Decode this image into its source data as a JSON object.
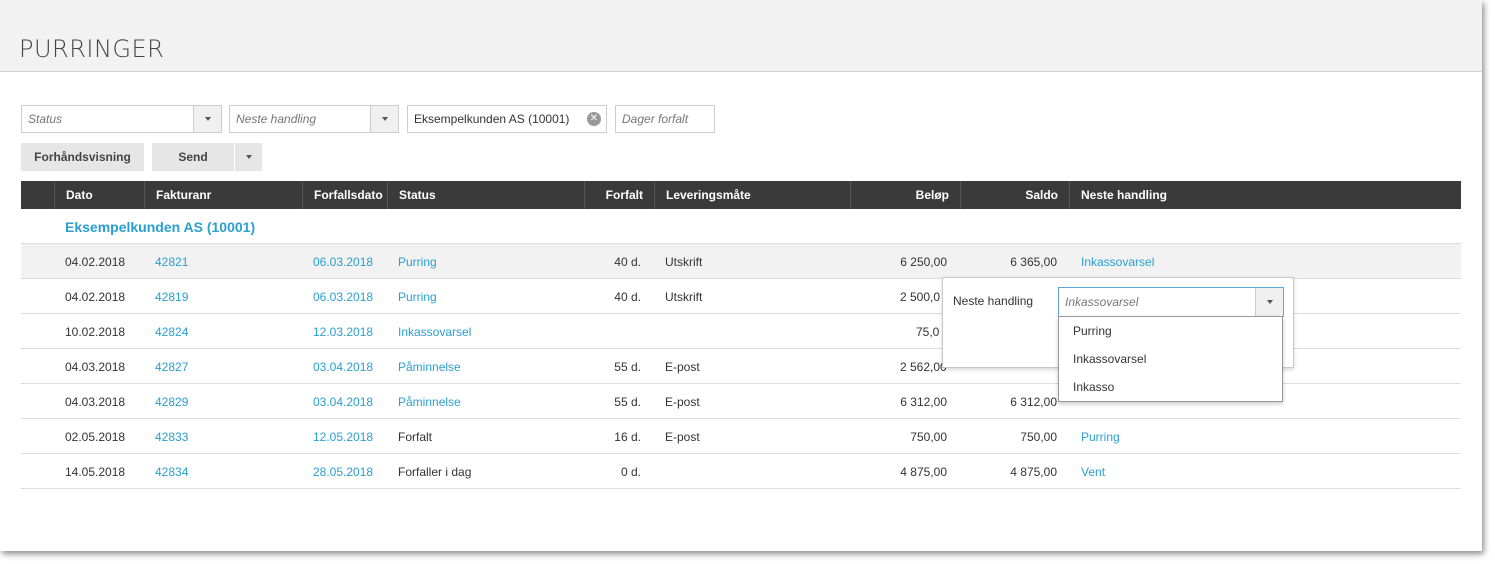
{
  "page": {
    "title": "PURRINGER"
  },
  "filters": {
    "status_placeholder": "Status",
    "neste_handling_placeholder": "Neste handling",
    "customer_value": "Eksempelkunden AS (10001)",
    "dager_forfalt_placeholder": "Dager forfalt"
  },
  "toolbar": {
    "preview_label": "Forhåndsvisning",
    "send_label": "Send"
  },
  "table": {
    "headers": [
      "Dato",
      "Fakturanr",
      "Forfallsdato",
      "Status",
      "Forfalt",
      "Leveringsmåte",
      "Beløp",
      "Saldo",
      "Neste handling"
    ],
    "group": "Eksempelkunden AS (10001)",
    "rows": [
      {
        "dato": "04.02.2018",
        "fakturanr": "42821",
        "forfallsdato": "06.03.2018",
        "status": "Purring",
        "forfalt": "40 d.",
        "levering": "Utskrift",
        "belop": "6 250,00",
        "saldo": "6 365,00",
        "neste": "Inkassovarsel"
      },
      {
        "dato": "04.02.2018",
        "fakturanr": "42819",
        "forfallsdato": "06.03.2018",
        "status": "Purring",
        "forfalt": "40 d.",
        "levering": "Utskrift",
        "belop": "2 500,0",
        "saldo": "",
        "neste": ""
      },
      {
        "dato": "10.02.2018",
        "fakturanr": "42824",
        "forfallsdato": "12.03.2018",
        "status": "Inkassovarsel",
        "forfalt": "",
        "levering": "",
        "belop": "75,0",
        "saldo": "",
        "neste": ""
      },
      {
        "dato": "04.03.2018",
        "fakturanr": "42827",
        "forfallsdato": "03.04.2018",
        "status": "Påminnelse",
        "forfalt": "55 d.",
        "levering": "E-post",
        "belop": "2 562,00",
        "saldo": "",
        "neste": ""
      },
      {
        "dato": "04.03.2018",
        "fakturanr": "42829",
        "forfallsdato": "03.04.2018",
        "status": "Påminnelse",
        "forfalt": "55 d.",
        "levering": "E-post",
        "belop": "6 312,00",
        "saldo": "6 312,00",
        "neste": ""
      },
      {
        "dato": "02.05.2018",
        "fakturanr": "42833",
        "forfallsdato": "12.05.2018",
        "status": "Forfalt",
        "forfalt": "16 d.",
        "levering": "E-post",
        "belop": "750,00",
        "saldo": "750,00",
        "neste": "Purring"
      },
      {
        "dato": "14.05.2018",
        "fakturanr": "42834",
        "forfallsdato": "28.05.2018",
        "status": "Forfaller i dag",
        "forfalt": "0 d.",
        "levering": "",
        "belop": "4 875,00",
        "saldo": "4 875,00",
        "neste": "Vent"
      }
    ]
  },
  "popup": {
    "label": "Neste handling",
    "placeholder": "Inkassovarsel",
    "options": [
      "Purring",
      "Inkassovarsel",
      "Inkasso"
    ]
  },
  "colors": {
    "link": "#2a9fd0",
    "header_bg": "#3a3a3a"
  }
}
